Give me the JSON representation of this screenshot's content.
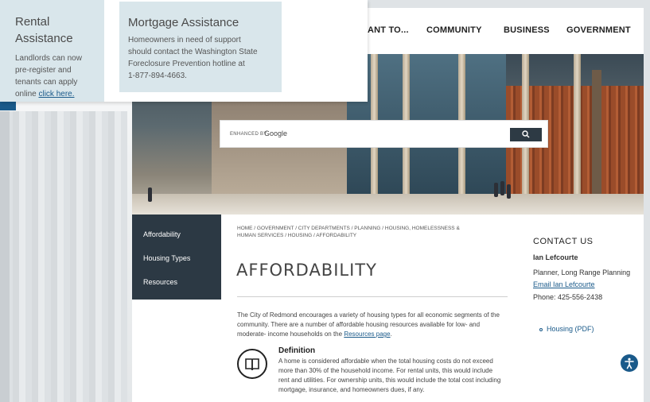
{
  "nav": {
    "items": [
      "ANT TO...",
      "COMMUNITY",
      "BUSINESS",
      "GOVERNMENT"
    ]
  },
  "search": {
    "prefix": "ENHANCED BY",
    "brand": "Google",
    "placeholder": ""
  },
  "sidenav": {
    "items": [
      "Affordability",
      "Housing Types",
      "Resources"
    ]
  },
  "breadcrumb": {
    "text": "HOME / GOVERNMENT / CITY DEPARTMENTS / PLANNING / HOUSING, HOMELESSNESS & HUMAN SERVICES / HOUSING / AFFORDABILITY"
  },
  "main": {
    "title": "AFFORDABILITY",
    "intro_before": "The City of Redmond encourages a variety of housing types for all economic segments of the community. There are a number of affordable housing resources available for low- and moderate- income households on the ",
    "intro_link": "Resources page",
    "intro_after": ".",
    "definition": {
      "title": "Definition",
      "text": "A home is considered affordable when the total housing costs do not exceed more than 30% of the household income. For rental units, this would include rent and utilities. For ownership units, this would include the total cost including mortgage, insurance, and homeowners dues, if any."
    }
  },
  "contact": {
    "title": "CONTACT US",
    "name": "Ian Lefcourte",
    "role": "Planner, Long Range Planning",
    "email_label": "Email Ian Lefcourte",
    "phone": "Phone: 425-556-2438",
    "housing_link": "Housing (PDF)"
  },
  "overlay": {
    "rental": {
      "title_line1": "Rental",
      "title_line2": "Assistance",
      "text_line1": "Landlords can now",
      "text_line2": "pre-register and",
      "text_line3": "tenants can apply",
      "text_line4": "online",
      "link": "click here."
    },
    "mortgage": {
      "title": "Mortgage Assistance",
      "text_line1": "Homeowners in need of support",
      "text_line2": "should contact the Washington State",
      "text_line3": "Foreclosure Prevention hotline at",
      "text_line4": "1-877-894-4663."
    }
  },
  "colors": {
    "navy": "#2c3944",
    "link": "#1a5a8a",
    "card": "#d9e6eb"
  }
}
